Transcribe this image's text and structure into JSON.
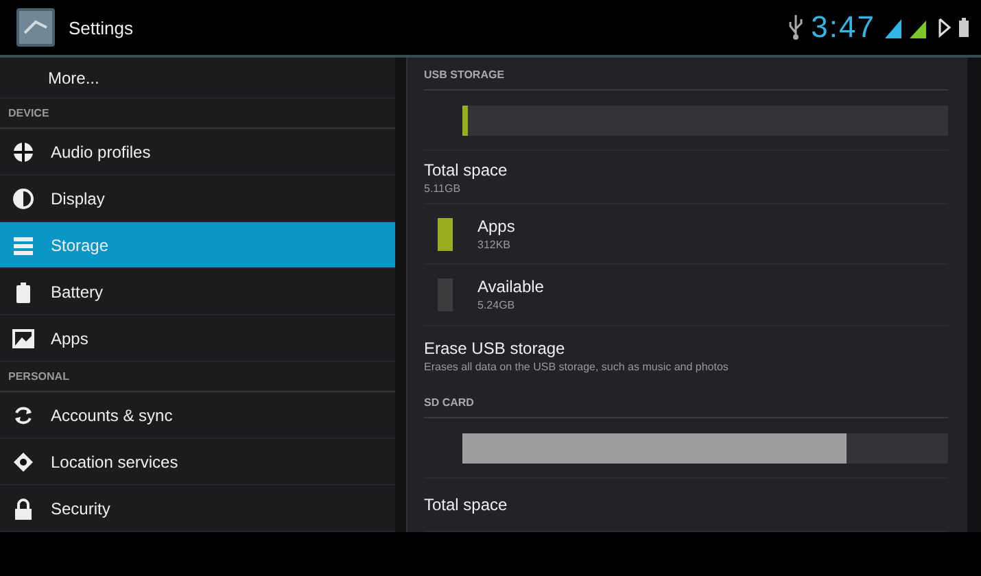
{
  "action_bar": {
    "title": "Settings"
  },
  "status_bar": {
    "time": "3:47"
  },
  "sidebar": {
    "items": [
      {
        "kind": "item",
        "label": "More...",
        "selected": false
      },
      {
        "kind": "header",
        "label": "DEVICE"
      },
      {
        "kind": "item",
        "label": "Audio profiles",
        "selected": false
      },
      {
        "kind": "item",
        "label": "Display",
        "selected": false
      },
      {
        "kind": "item",
        "label": "Storage",
        "selected": true
      },
      {
        "kind": "item",
        "label": "Battery",
        "selected": false
      },
      {
        "kind": "item",
        "label": "Apps",
        "selected": false
      },
      {
        "kind": "header",
        "label": "PERSONAL"
      },
      {
        "kind": "item",
        "label": "Accounts & sync",
        "selected": false
      },
      {
        "kind": "item",
        "label": "Location services",
        "selected": false
      },
      {
        "kind": "item",
        "label": "Security",
        "selected": false
      }
    ]
  },
  "storage": {
    "rows": [
      {
        "kind": "header",
        "label": "USB STORAGE"
      },
      {
        "kind": "bar",
        "level": 0.01,
        "color": "#9aad1e"
      },
      {
        "kind": "total",
        "title": "Total space",
        "value": "5.11GB"
      },
      {
        "kind": "category",
        "title": "Apps",
        "value": "312KB",
        "color": "#9aad1e"
      },
      {
        "kind": "category",
        "title": "Available",
        "value": "5.24GB",
        "color": "#3c3c3c"
      },
      {
        "kind": "action",
        "title": "Erase USB storage",
        "summary": "Erases all data on the USB storage, such as music and photos"
      },
      {
        "kind": "header",
        "label": "SD CARD"
      },
      {
        "kind": "bar",
        "level": 0.79,
        "color": "#9e9e9e"
      },
      {
        "kind": "total",
        "title": "Total space"
      }
    ]
  }
}
